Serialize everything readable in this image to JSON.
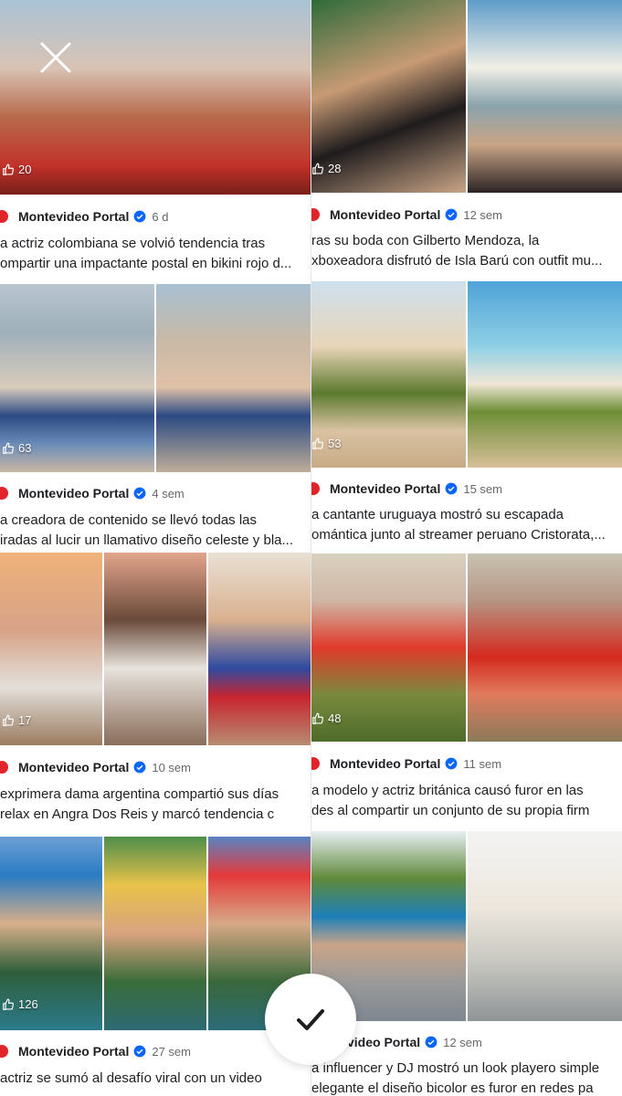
{
  "author": "Montevideo Portal",
  "colors": {
    "accent": "#0866ff",
    "avatar": "#e0242a",
    "muted": "#65676b"
  },
  "icons": {
    "close": "close-icon",
    "confirm": "checkmark-icon",
    "like": "thumbs-up-icon",
    "verified": "verified-badge-icon"
  },
  "left_posts": [
    {
      "likes": "20",
      "age": "6 d",
      "line1": "a actriz colombiana se volvió tendencia tras",
      "line2": "ompartir una impactante postal en bikini rojo d..."
    },
    {
      "likes": "63",
      "age": "4 sem",
      "line1": "a creadora de contenido se llevó todas las",
      "line2": "iradas al lucir un llamativo diseño celeste y bla..."
    },
    {
      "likes": "17",
      "age": "10 sem",
      "line1": "exprimera dama argentina compartió sus días",
      "line2": "relax en Angra Dos Reis y marcó tendencia c"
    },
    {
      "likes": "126",
      "age": "27 sem",
      "line1": "actriz se sumó al desafío viral con un video",
      "line2": ""
    }
  ],
  "right_posts": [
    {
      "likes": "28",
      "author": "Montevideo Portal",
      "age": "12 sem",
      "line1": "ras su boda con Gilberto Mendoza, la",
      "line2": "xboxeadora disfrutó de Isla Barú con outfit mu..."
    },
    {
      "likes": "53",
      "author": "Montevideo Portal",
      "age": "15 sem",
      "line1": "a cantante uruguaya mostró su escapada",
      "line2": "omántica junto al streamer peruano Cristorata,..."
    },
    {
      "likes": "48",
      "author": "Montevideo Portal",
      "age": "11 sem",
      "line1": "a modelo y actriz británica causó furor en las",
      "line2": "des al compartir un conjunto de su propia firm"
    },
    {
      "likes": "",
      "author": "ntevideo Portal",
      "age": "12 sem",
      "line1": "a influencer y DJ mostró un look playero simple",
      "line2": "elegante el diseño bicolor es furor en redes pa"
    }
  ]
}
